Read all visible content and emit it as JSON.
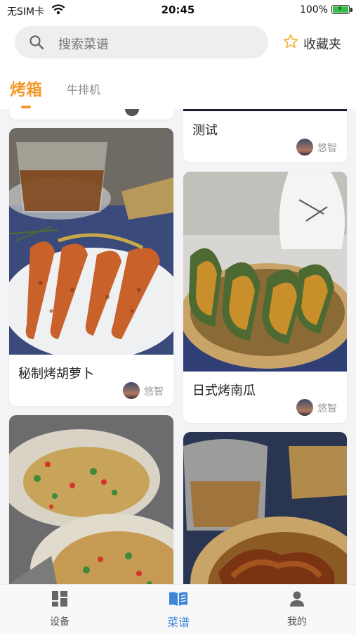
{
  "status": {
    "carrier": "无SIM卡",
    "time": "20:45",
    "battery": "100%"
  },
  "header": {
    "search_placeholder": "搜索菜谱",
    "favorites_label": "收藏夹"
  },
  "tabs": [
    {
      "label": "烤箱",
      "active": true
    },
    {
      "label": "牛排机",
      "active": false
    }
  ],
  "recipes": [
    {
      "title": "测试",
      "author": "悠智"
    },
    {
      "title": "秘制烤胡萝卜",
      "author": "悠智"
    },
    {
      "title": "日式烤南瓜",
      "author": "悠智"
    },
    {
      "title": "",
      "author": ""
    },
    {
      "title": "",
      "author": ""
    }
  ],
  "nav": [
    {
      "label": "设备",
      "icon": "device-grid-icon",
      "active": false
    },
    {
      "label": "菜谱",
      "icon": "recipe-book-icon",
      "active": true
    },
    {
      "label": "我的",
      "icon": "person-icon",
      "active": false
    }
  ],
  "colors": {
    "accent": "#f39a2a",
    "nav_active": "#3f86d8"
  }
}
